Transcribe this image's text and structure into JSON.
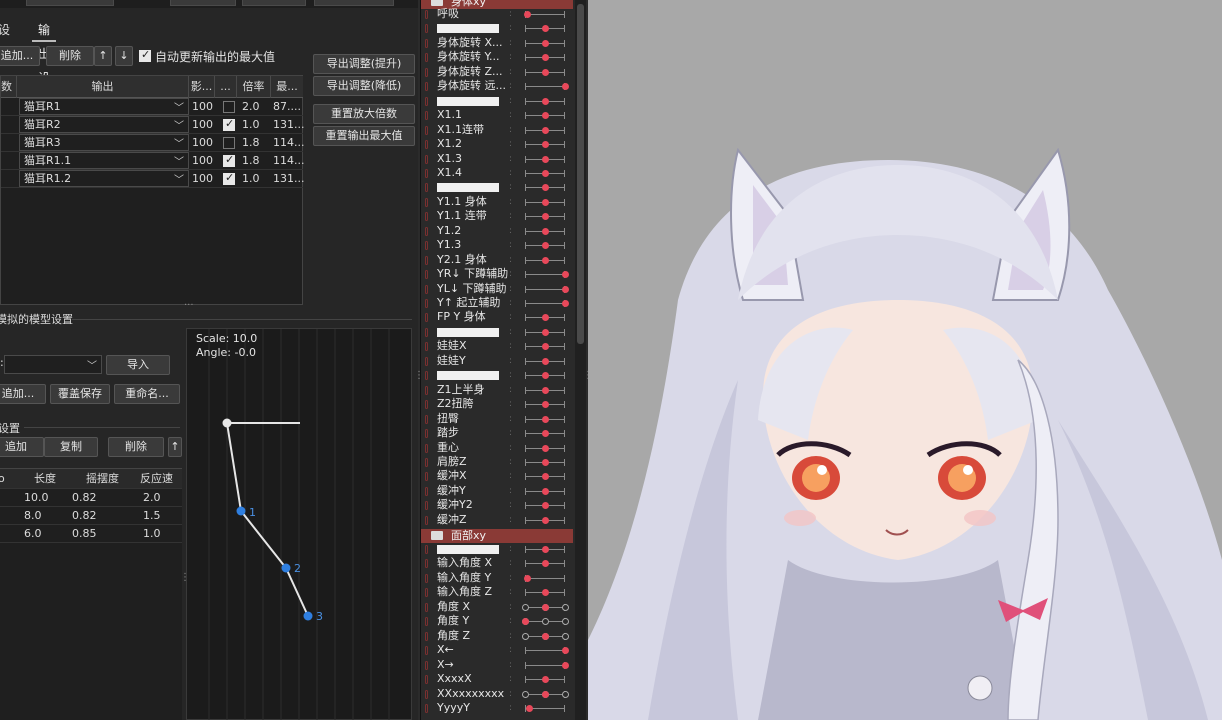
{
  "tabs": [
    {
      "label": "设置"
    },
    {
      "label": "输出设置"
    }
  ],
  "toolbar": {
    "add_label": "追加...",
    "delete_label": "削除",
    "up_label": "↑",
    "down_label": "↓",
    "auto_update_label": "自动更新输出的最大值",
    "export_up_label": "导出调整(提升)",
    "export_down_label": "导出调整(降低)",
    "reset_scale_label": "重置放大倍数",
    "reset_max_label": "重置输出最大值"
  },
  "output_table": {
    "headers": [
      "数",
      "输出",
      "影...",
      "...",
      "倍率",
      "最..."
    ],
    "rows": [
      {
        "output": "猫耳R1",
        "influence": "100",
        "checked": false,
        "ratio": "2.0",
        "max": "87...."
      },
      {
        "output": "猫耳R2",
        "influence": "100",
        "checked": true,
        "ratio": "1.0",
        "max": "131..."
      },
      {
        "output": "猫耳R3",
        "influence": "100",
        "checked": false,
        "ratio": "1.8",
        "max": "114..."
      },
      {
        "output": "猫耳R1.1",
        "influence": "100",
        "checked": true,
        "ratio": "1.8",
        "max": "114..."
      },
      {
        "output": "猫耳R1.2",
        "influence": "100",
        "checked": true,
        "ratio": "1.0",
        "max": "131..."
      }
    ]
  },
  "model_settings": {
    "title": "模拟的模型设置",
    "import_label": "导入",
    "add_label": "追加...",
    "overwrite_label": "覆盖保存",
    "rename_label": "重命名...",
    "prefix_label": ":"
  },
  "pendulum_settings": {
    "title": "设置",
    "add_label": "追加",
    "copy_label": "复制",
    "delete_label": "削除",
    "headers": [
      "o",
      "长度",
      "摇摆度",
      "反应速"
    ],
    "rows": [
      {
        "length": "10.0",
        "sway": "0.82",
        "react": "2.0"
      },
      {
        "length": "8.0",
        "sway": "0.82",
        "react": "1.5"
      },
      {
        "length": "6.0",
        "sway": "0.85",
        "react": "1.0"
      }
    ]
  },
  "graph": {
    "scale_label": "Scale: 10.0",
    "angle_label": "Angle: -0.0",
    "point_labels": [
      "1",
      "2",
      "3"
    ]
  },
  "params": {
    "group1": "身体xy",
    "group2": "面部xy",
    "rows1": [
      {
        "name": "呼吸",
        "pos": 0.05
      },
      {
        "name": "",
        "pos": 0.5
      },
      {
        "name": "身体旋转 X...",
        "pos": 0.5
      },
      {
        "name": "身体旋转 Y...",
        "pos": 0.5
      },
      {
        "name": "身体旋转 Z...",
        "pos": 0.5
      },
      {
        "name": "身体旋转 远...",
        "pos": 1.0
      },
      {
        "name": "",
        "pos": 0.5
      },
      {
        "name": "X1.1",
        "pos": 0.5
      },
      {
        "name": "X1.1连带",
        "pos": 0.5
      },
      {
        "name": "X1.2",
        "pos": 0.5
      },
      {
        "name": "X1.3",
        "pos": 0.5
      },
      {
        "name": "X1.4",
        "pos": 0.5
      },
      {
        "name": "",
        "pos": 0.5
      },
      {
        "name": "Y1.1 身体",
        "pos": 0.5
      },
      {
        "name": "Y1.1 连带",
        "pos": 0.5
      },
      {
        "name": "Y1.2",
        "pos": 0.5
      },
      {
        "name": "Y1.3",
        "pos": 0.5
      },
      {
        "name": "Y2.1 身体",
        "pos": 0.5
      },
      {
        "name": "YR↓ 下蹲辅助",
        "pos": 1.0
      },
      {
        "name": "YL↓ 下蹲辅助",
        "pos": 1.0
      },
      {
        "name": "Y↑ 起立辅助",
        "pos": 1.0
      },
      {
        "name": "FP Y 身体",
        "pos": 0.5
      },
      {
        "name": "",
        "pos": 0.5
      },
      {
        "name": "娃娃X",
        "pos": 0.5
      },
      {
        "name": "娃娃Y",
        "pos": 0.5
      },
      {
        "name": "",
        "pos": 0.5
      },
      {
        "name": "Z1上半身",
        "pos": 0.5
      },
      {
        "name": "Z2扭胯",
        "pos": 0.5
      },
      {
        "name": "扭臀",
        "pos": 0.5
      },
      {
        "name": "踏步",
        "pos": 0.5
      },
      {
        "name": "重心",
        "pos": 0.5
      },
      {
        "name": "肩膀Z",
        "pos": 0.5
      },
      {
        "name": "缓冲X",
        "pos": 0.5
      },
      {
        "name": "缓冲Y",
        "pos": 0.5
      },
      {
        "name": "缓冲Y2",
        "pos": 0.5
      },
      {
        "name": "缓冲Z",
        "pos": 0.5
      }
    ],
    "rows2": [
      {
        "name": "",
        "pos": 0.5
      },
      {
        "name": "输入角度 X",
        "pos": 0.5
      },
      {
        "name": "输入角度 Y",
        "pos": 0.05
      },
      {
        "name": "输入角度 Z",
        "pos": 0.5
      },
      {
        "name": "角度 X",
        "pos": 0.5,
        "rings": true
      },
      {
        "name": "角度 Y",
        "pos": 0.0,
        "rings": true
      },
      {
        "name": "角度 Z",
        "pos": 0.5,
        "rings": true
      },
      {
        "name": "X←",
        "pos": 1.0
      },
      {
        "name": "X→",
        "pos": 1.0
      },
      {
        "name": "XxxxX",
        "pos": 0.5
      },
      {
        "name": "XXxxxxxxxx",
        "pos": 0.5,
        "rings": true
      },
      {
        "name": "YyyyY",
        "pos": 0.1
      }
    ]
  },
  "colors": {
    "accent_red": "#e8485a",
    "group_header": "#8a3a36",
    "graph_point": "#2f7fe0",
    "viewport_bg": "#a8a8a8"
  }
}
